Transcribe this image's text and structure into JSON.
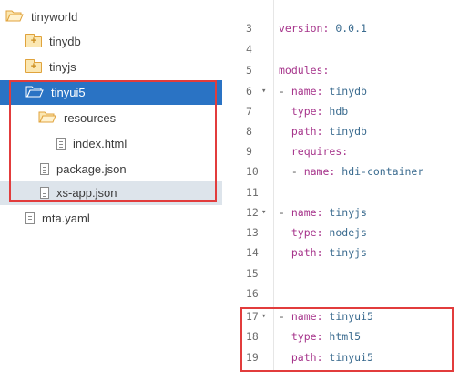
{
  "tree": {
    "root": {
      "label": "tinyworld",
      "icon": "open-folder-icon"
    },
    "items": [
      {
        "label": "tinydb",
        "icon": "folder-plus-icon"
      },
      {
        "label": "tinyjs",
        "icon": "folder-plus-icon"
      },
      {
        "label": "tinyui5",
        "icon": "open-folder-icon",
        "selected": true
      },
      {
        "label": "resources",
        "icon": "open-folder-icon"
      },
      {
        "label": "index.html",
        "icon": "file-icon"
      },
      {
        "label": "package.json",
        "icon": "file-icon"
      },
      {
        "label": "xs-app.json",
        "icon": "file-icon"
      },
      {
        "label": "mta.yaml",
        "icon": "file-icon"
      }
    ]
  },
  "editor": {
    "lines": [
      {
        "num": "3",
        "fold": "",
        "key": "version",
        "sep": ": ",
        "val": "0.0.1",
        "prefix": ""
      },
      {
        "num": "4",
        "fold": "",
        "key": "",
        "sep": "",
        "val": "",
        "prefix": ""
      },
      {
        "num": "5",
        "fold": "",
        "key": "modules",
        "sep": ":",
        "val": "",
        "prefix": ""
      },
      {
        "num": "6",
        "fold": "▾",
        "key": "name",
        "sep": ": ",
        "val": "tinydb",
        "prefix": "- "
      },
      {
        "num": "7",
        "fold": "",
        "key": "type",
        "sep": ": ",
        "val": "hdb",
        "prefix": "  "
      },
      {
        "num": "8",
        "fold": "",
        "key": "path",
        "sep": ": ",
        "val": "tinydb",
        "prefix": "  "
      },
      {
        "num": "9",
        "fold": "",
        "key": "requires",
        "sep": ":",
        "val": "",
        "prefix": "  "
      },
      {
        "num": "10",
        "fold": "",
        "key": "name",
        "sep": ": ",
        "val": "hdi-container",
        "prefix": "  - "
      },
      {
        "num": "11",
        "fold": "",
        "key": "",
        "sep": "",
        "val": "",
        "prefix": ""
      },
      {
        "num": "12",
        "fold": "▾",
        "key": "name",
        "sep": ": ",
        "val": "tinyjs",
        "prefix": "- "
      },
      {
        "num": "13",
        "fold": "",
        "key": "type",
        "sep": ": ",
        "val": "nodejs",
        "prefix": "  "
      },
      {
        "num": "14",
        "fold": "",
        "key": "path",
        "sep": ": ",
        "val": "tinyjs",
        "prefix": "  "
      },
      {
        "num": "15",
        "fold": "",
        "key": "",
        "sep": "",
        "val": "",
        "prefix": ""
      },
      {
        "num": "16",
        "fold": "",
        "key": "",
        "sep": "",
        "val": "",
        "prefix": ""
      },
      {
        "num": "17",
        "fold": "▾",
        "key": "name",
        "sep": ": ",
        "val": "tinyui5",
        "prefix": "- "
      },
      {
        "num": "18",
        "fold": "",
        "key": "type",
        "sep": ": ",
        "val": "html5",
        "prefix": "  "
      },
      {
        "num": "19",
        "fold": "",
        "key": "path",
        "sep": ": ",
        "val": "tinyui5",
        "prefix": "  "
      }
    ]
  },
  "colors": {
    "selection": "#2a73c4",
    "highlight_box": "#e23c3c",
    "yaml_key": "#a6348b",
    "yaml_value": "#3a6b8f"
  }
}
